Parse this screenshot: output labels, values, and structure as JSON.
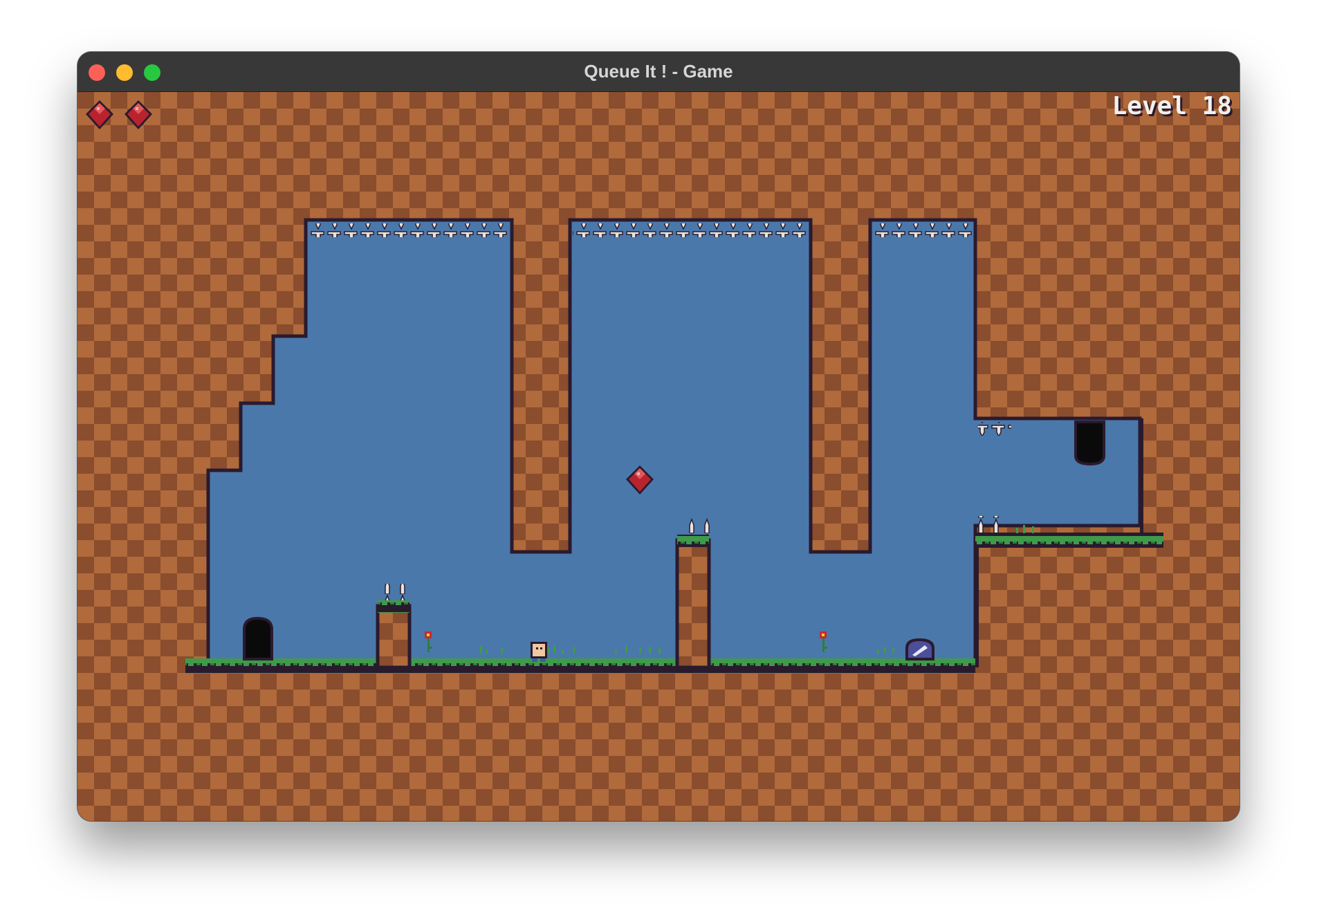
{
  "window": {
    "title": "Queue It ! - Game"
  },
  "hud": {
    "level_label": "Level 18",
    "lives": 2,
    "life_icon": "red-gem-icon"
  },
  "colors": {
    "dirt_light": "#b06a3b",
    "dirt_dark": "#8a4d2d",
    "sky": "#4a78ab",
    "outline": "#2a1a2e",
    "grass": "#3f9a4a",
    "gem": "#b8232e",
    "spike": "#e6e3dc",
    "slime": "#4b4f9a"
  }
}
